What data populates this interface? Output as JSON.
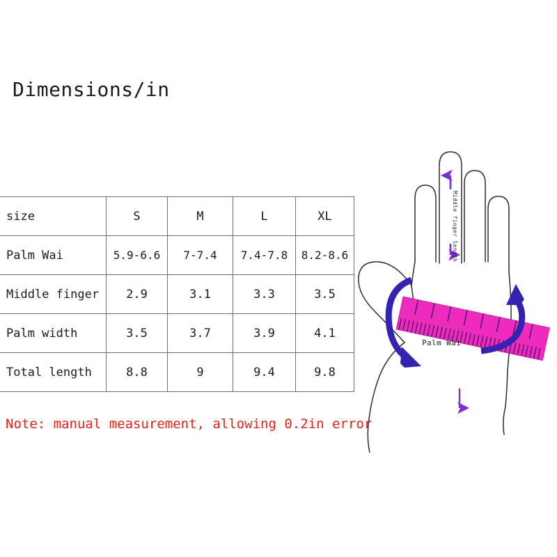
{
  "title": "Dimensions/in",
  "table": {
    "columns": [
      "size",
      "S",
      "M",
      "L",
      "XL"
    ],
    "rows": [
      {
        "label": "Palm Wai",
        "values": [
          "5.9-6.6",
          "7-7.4",
          "7.4-7.8",
          "8.2-8.6"
        ]
      },
      {
        "label": "Middle finger",
        "values": [
          "2.9",
          "3.1",
          "3.3",
          "3.5"
        ]
      },
      {
        "label": "Palm width",
        "values": [
          "3.5",
          "3.7",
          "3.9",
          "4.1"
        ]
      },
      {
        "label": "Total length",
        "values": [
          "8.8",
          "9",
          "9.4",
          "9.8"
        ]
      }
    ]
  },
  "note": "Note: manual measurement, allowing 0.2in error",
  "diagram": {
    "middle_finger_label": "Middle finger length",
    "palm_wai_label": "Palm Wai",
    "colors": {
      "hand_outline": "#2b2b2b",
      "ruler": "#ed2bbd",
      "ruler_tick": "#6b1a7a",
      "measure_arrow": "#7b2fd4",
      "wrap_arrow": "#3323b0",
      "note": "#e2231a",
      "table_border": "#6d6d6d",
      "text": "#1a1a1a"
    }
  }
}
